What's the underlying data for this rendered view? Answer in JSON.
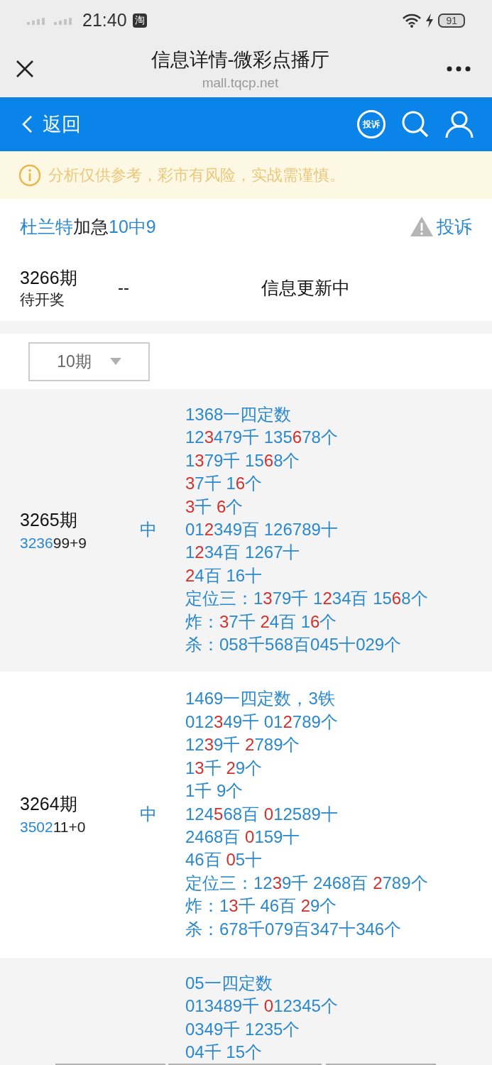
{
  "status_bar": {
    "time": "21:40",
    "app_badge": "淘",
    "battery": "91"
  },
  "browser": {
    "title": "信息详情-微彩点播厅",
    "url": "mall.tqcp.net"
  },
  "nav": {
    "back": "返回",
    "complain_badge": "投诉"
  },
  "notice": "分析仅供参考，彩市有风险，实战需谨慎。",
  "header": {
    "title": [
      {
        "text": "杜兰特",
        "accent": true
      },
      {
        "text": "加急",
        "accent": false
      },
      {
        "text": "10中9",
        "accent": true
      }
    ],
    "complain": "投诉",
    "current": {
      "period": "3266期",
      "status": "待开奖",
      "result": "--",
      "info": "信息更新中"
    }
  },
  "filter": {
    "value": "10期"
  },
  "records": [
    {
      "period": "3265期",
      "draw": [
        {
          "text": "3236",
          "accent": true
        },
        {
          "text": "99+9",
          "accent": false
        }
      ],
      "verdict": "中",
      "lines": [
        [
          {
            "text": "1368一四定数",
            "hit": false
          }
        ],
        [
          {
            "text": "12",
            "hit": false
          },
          {
            "text": "3",
            "hit": true
          },
          {
            "text": "479千 135",
            "hit": false
          },
          {
            "text": "6",
            "hit": true
          },
          {
            "text": "78个",
            "hit": false
          }
        ],
        [
          {
            "text": "1",
            "hit": false
          },
          {
            "text": "3",
            "hit": true
          },
          {
            "text": "79千 15",
            "hit": false
          },
          {
            "text": "6",
            "hit": true
          },
          {
            "text": "8个",
            "hit": false
          }
        ],
        [
          {
            "text": "3",
            "hit": true
          },
          {
            "text": "7千 1",
            "hit": false
          },
          {
            "text": "6",
            "hit": true
          },
          {
            "text": "个",
            "hit": false
          }
        ],
        [
          {
            "text": "3",
            "hit": true
          },
          {
            "text": "千 ",
            "hit": false
          },
          {
            "text": "6",
            "hit": true
          },
          {
            "text": "个",
            "hit": false
          }
        ],
        [
          {
            "text": "01",
            "hit": false
          },
          {
            "text": "2",
            "hit": true
          },
          {
            "text": "349百 126789十",
            "hit": false
          }
        ],
        [
          {
            "text": "1",
            "hit": false
          },
          {
            "text": "2",
            "hit": true
          },
          {
            "text": "34百 1267十",
            "hit": false
          }
        ],
        [
          {
            "text": "2",
            "hit": true
          },
          {
            "text": "4百 16十",
            "hit": false
          }
        ],
        [
          {
            "text": "定位三：1",
            "hit": false
          },
          {
            "text": "3",
            "hit": true
          },
          {
            "text": "79千 1",
            "hit": false
          },
          {
            "text": "2",
            "hit": true
          },
          {
            "text": "34百 15",
            "hit": false
          },
          {
            "text": "6",
            "hit": true
          },
          {
            "text": "8个",
            "hit": false
          }
        ],
        [
          {
            "text": "炸：",
            "hit": false
          },
          {
            "text": "3",
            "hit": true
          },
          {
            "text": "7千 ",
            "hit": false
          },
          {
            "text": "2",
            "hit": true
          },
          {
            "text": "4百 1",
            "hit": false
          },
          {
            "text": "6",
            "hit": true
          },
          {
            "text": "个",
            "hit": false
          }
        ],
        [
          {
            "text": "杀：058千568百045十029个",
            "hit": false
          }
        ]
      ]
    },
    {
      "period": "3264期",
      "draw": [
        {
          "text": "3502",
          "accent": true
        },
        {
          "text": "11+0",
          "accent": false
        }
      ],
      "verdict": "中",
      "lines": [
        [
          {
            "text": "1469一四定数，3铁",
            "hit": false
          }
        ],
        [
          {
            "text": "012",
            "hit": false
          },
          {
            "text": "3",
            "hit": true
          },
          {
            "text": "49千 01",
            "hit": false
          },
          {
            "text": "2",
            "hit": true
          },
          {
            "text": "789个",
            "hit": false
          }
        ],
        [
          {
            "text": "12",
            "hit": false
          },
          {
            "text": "3",
            "hit": true
          },
          {
            "text": "9千 ",
            "hit": false
          },
          {
            "text": "2",
            "hit": true
          },
          {
            "text": "789个",
            "hit": false
          }
        ],
        [
          {
            "text": "1",
            "hit": false
          },
          {
            "text": "3",
            "hit": true
          },
          {
            "text": "千 ",
            "hit": false
          },
          {
            "text": "2",
            "hit": true
          },
          {
            "text": "9个",
            "hit": false
          }
        ],
        [
          {
            "text": "1千 9个",
            "hit": false
          }
        ],
        [
          {
            "text": "124",
            "hit": false
          },
          {
            "text": "5",
            "hit": true
          },
          {
            "text": "68百 ",
            "hit": false
          },
          {
            "text": "0",
            "hit": true
          },
          {
            "text": "12589十",
            "hit": false
          }
        ],
        [
          {
            "text": "2468百 ",
            "hit": false
          },
          {
            "text": "0",
            "hit": true
          },
          {
            "text": "159十",
            "hit": false
          }
        ],
        [
          {
            "text": "46百 ",
            "hit": false
          },
          {
            "text": "0",
            "hit": true
          },
          {
            "text": "5十",
            "hit": false
          }
        ],
        [
          {
            "text": "定位三：12",
            "hit": false
          },
          {
            "text": "3",
            "hit": true
          },
          {
            "text": "9千 2468百 ",
            "hit": false
          },
          {
            "text": "2",
            "hit": true
          },
          {
            "text": "789个",
            "hit": false
          }
        ],
        [
          {
            "text": "炸：1",
            "hit": false
          },
          {
            "text": "3",
            "hit": true
          },
          {
            "text": "千 46百 ",
            "hit": false
          },
          {
            "text": "2",
            "hit": true
          },
          {
            "text": "9个",
            "hit": false
          }
        ],
        [
          {
            "text": "杀：678千079百347十346个",
            "hit": false
          }
        ]
      ]
    },
    {
      "lines": [
        [
          {
            "text": "05一四定数",
            "hit": false
          }
        ],
        [
          {
            "text": "013489千 ",
            "hit": false
          },
          {
            "text": "0",
            "hit": true
          },
          {
            "text": "12345个",
            "hit": false
          }
        ],
        [
          {
            "text": "0349千 1235个",
            "hit": false
          }
        ],
        [
          {
            "text": "04千 15个",
            "hit": false
          }
        ]
      ]
    }
  ]
}
